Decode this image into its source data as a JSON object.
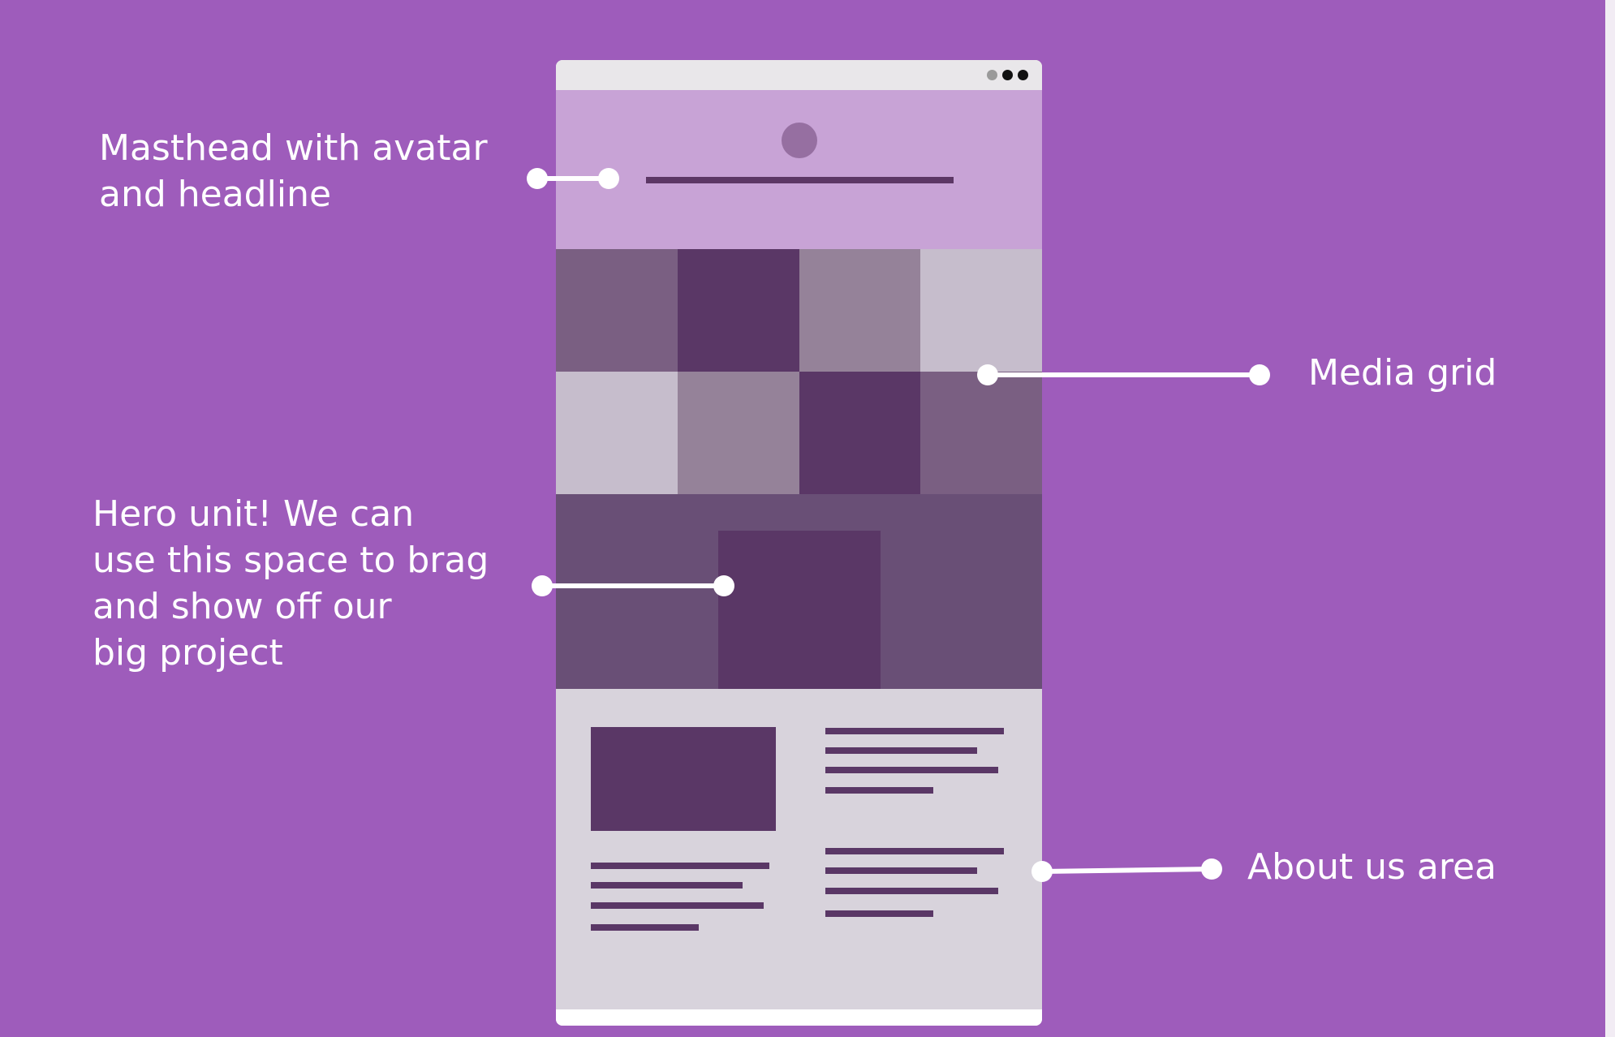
{
  "colors": {
    "background": "#9e5cbb",
    "masthead": "#c8a3d6",
    "dark_purple": "#5a3766",
    "hero": "#694f76",
    "about": "#d8d3dc",
    "titlebar": "#e9e7ea",
    "grid_tiles": [
      "#7a5f82",
      "#5a3766",
      "#958299",
      "#c6bdcc",
      "#c6bdcc",
      "#958299",
      "#5a3766",
      "#7a5f82"
    ]
  },
  "window_dots": [
    {
      "color": "#9a9a9a"
    },
    {
      "color": "#111111"
    },
    {
      "color": "#111111"
    }
  ],
  "annotations": {
    "masthead": "Masthead with avatar\nand headline",
    "media_grid": "Media grid",
    "hero": "Hero unit! We can\nuse this space to brag\nand show off our\nbig project",
    "about": "About us area"
  }
}
